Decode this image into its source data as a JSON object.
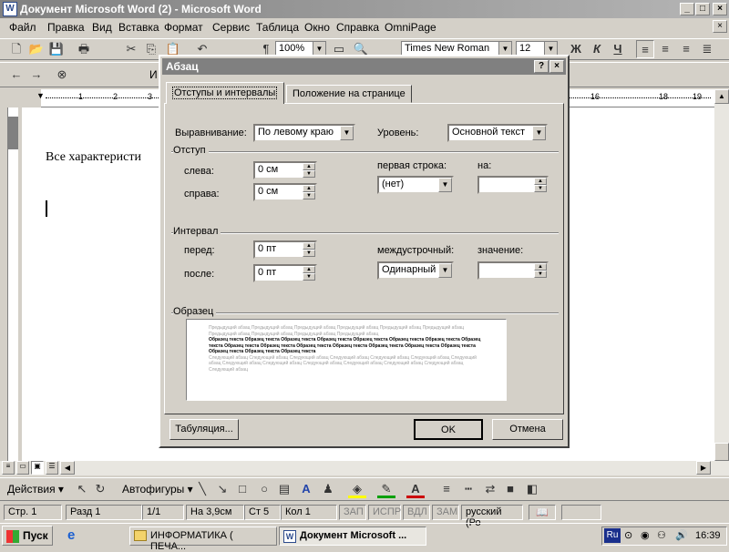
{
  "window": {
    "title": "Документ Microsoft Word (2) - Microsoft Word",
    "btn_min": "_",
    "btn_max": "□",
    "btn_close": "×"
  },
  "menu": [
    "Файл",
    "Правка",
    "Вид",
    "Вставка",
    "Формат",
    "Сервис",
    "Таблица",
    "Окно",
    "Справка",
    "OmniPage"
  ],
  "toolbar": {
    "zoom": "100%",
    "font": "Times New Roman",
    "size": "12",
    "bold": "Ж",
    "italic": "К",
    "underline": "Ч"
  },
  "ruler": {
    "marks": [
      "1",
      "2",
      "3",
      "16",
      "18",
      "19"
    ]
  },
  "document": {
    "text": "Все характеристи"
  },
  "dialog": {
    "title": "Абзац",
    "help": "?",
    "close": "×",
    "tabs": [
      "Отступы и интервалы",
      "Положение на странице"
    ],
    "alignment_label": "Выравнивание:",
    "alignment_value": "По левому краю",
    "level_label": "Уровень:",
    "level_value": "Основной текст",
    "indent_group": "Отступ",
    "left_label": "слева:",
    "left_value": "0 см",
    "right_label": "справа:",
    "right_value": "0 см",
    "first_line_label": "первая строка:",
    "first_line_value": "(нет)",
    "by_label": "на:",
    "by_value": "",
    "spacing_group": "Интервал",
    "before_label": "перед:",
    "before_value": "0 пт",
    "after_label": "после:",
    "after_value": "0 пт",
    "line_spacing_label": "междустрочный:",
    "line_spacing_value": "Одинарный",
    "value_label": "значение:",
    "value_value": "",
    "sample_group": "Образец",
    "preview": {
      "prev": "Предыдущий абзац Предыдущий абзац Предыдущий абзац Предыдущий абзац Предыдущий абзац Предыдущий абзац Предыдущий абзац Предыдущий абзац Предыдущий абзац Предыдущий абзац",
      "sample": "Образец текста Образец текста Образец текста Образец текста Образец текста Образец текста Образец текста Образец текста Образец текста Образец текста Образец текста Образец текста Образец текста Образец текста Образец текста Образец текста Образец текста Образец текста",
      "next": "Следующий абзац Следующий абзац Следующий абзац Следующий абзац Следующий абзац Следующий абзац Следующий абзац Следующий абзац Следующий абзац Следующий абзац Следующий абзац Следующий абзац Следующий абзац Следующий абзац"
    },
    "tabs_button": "Табуляция...",
    "ok": "OK",
    "cancel": "Отмена"
  },
  "drawbar": {
    "actions": "Действия",
    "autoshapes": "Автофигуры"
  },
  "status": {
    "page": "Стр. 1",
    "section": "Разд 1",
    "pages": "1/1",
    "at": "На 3,9см",
    "line": "Ст 5",
    "col": "Кол 1",
    "rec": "ЗАП",
    "trk": "ИСПР",
    "ext": "ВДЛ",
    "ovr": "ЗАМ",
    "lang": "русский (Ро"
  },
  "taskbar": {
    "start": "Пуск",
    "task1": "ИНФОРМАТИКА ( ПЕЧА...",
    "task2": "Документ Microsoft ...",
    "lang": "Ru",
    "time": "16:39"
  },
  "colors": {
    "title_inactive": "#808080",
    "dialog_bg": "#d4d0c8",
    "font_color_a": "#cc0000",
    "highlight": "#ffff00"
  }
}
